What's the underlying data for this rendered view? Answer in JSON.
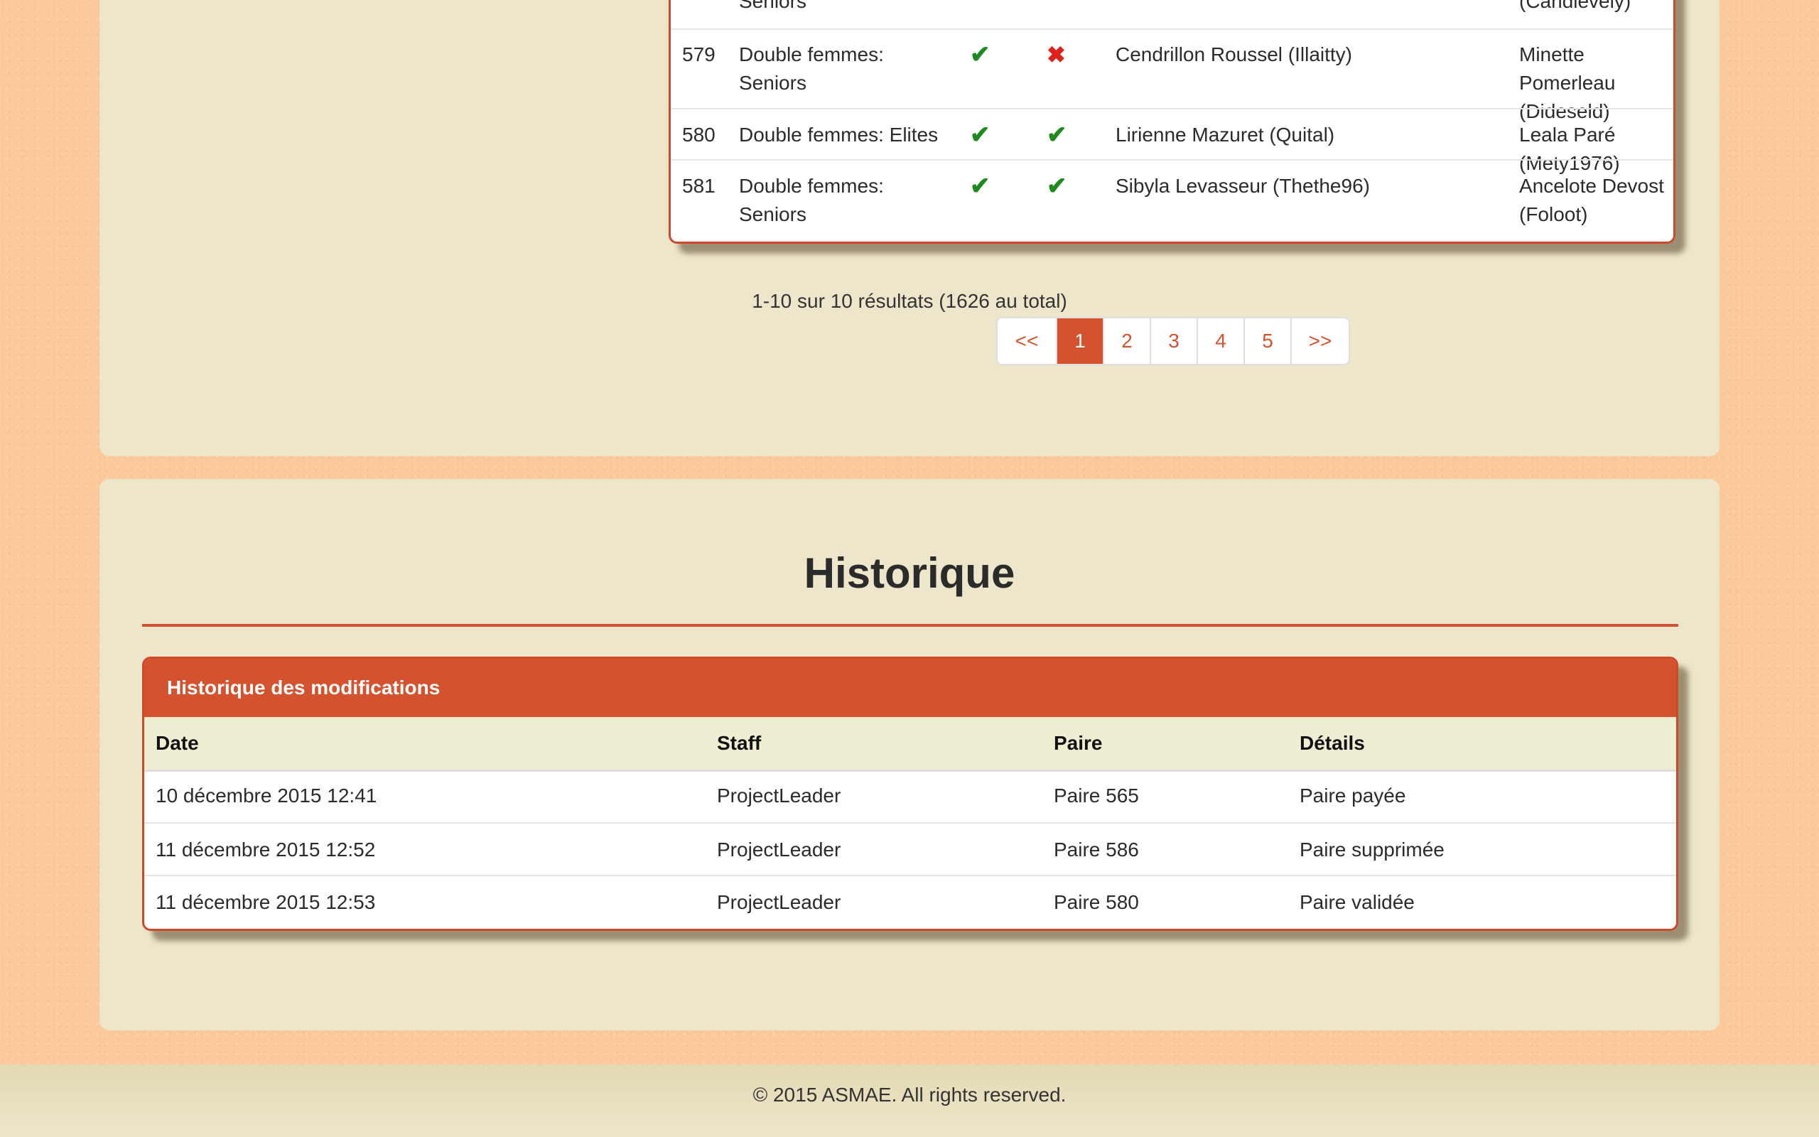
{
  "pairs_table": {
    "rows": [
      {
        "id": "",
        "category": "Seniors",
        "col1": "",
        "col2": "",
        "player1": "",
        "player2": "(Candievely)"
      },
      {
        "id": "579",
        "category": "Double femmes: Seniors",
        "col1": "check",
        "col2": "cross",
        "player1": "Cendrillon Roussel (Illaitty)",
        "player2": "Minette Pomerleau (Dideseld)"
      },
      {
        "id": "580",
        "category": "Double femmes: Elites",
        "col1": "check",
        "col2": "check",
        "player1": "Lirienne Mazuret (Quital)",
        "player2": "Leala Paré (Mety1976)"
      },
      {
        "id": "581",
        "category": "Double femmes: Seniors",
        "col1": "check",
        "col2": "check",
        "player1": "Sibyla Levasseur (Thethe96)",
        "player2": "Ancelote Devost (Foloot)"
      }
    ],
    "glyphs": {
      "check": "✔",
      "cross": "✖"
    },
    "colors": {
      "check": "#1f8a1f",
      "cross": "#e0201a"
    }
  },
  "pagination": {
    "summary": "1-10 sur 10 résultats (1626 au total)",
    "first": "<<",
    "pages": [
      "1",
      "2",
      "3",
      "4",
      "5"
    ],
    "current": "1",
    "last": ">>"
  },
  "history": {
    "title": "Historique",
    "panel_title": "Historique des modifications",
    "columns": {
      "date": "Date",
      "staff": "Staff",
      "pair": "Paire",
      "details": "Détails"
    },
    "rows": [
      {
        "date": "10 décembre 2015 12:41",
        "staff": "ProjectLeader",
        "pair": "Paire 565",
        "details": "Paire payée"
      },
      {
        "date": "11 décembre 2015 12:52",
        "staff": "ProjectLeader",
        "pair": "Paire 586",
        "details": "Paire supprimée"
      },
      {
        "date": "11 décembre 2015 12:53",
        "staff": "ProjectLeader",
        "pair": "Paire 580",
        "details": "Paire validée"
      }
    ]
  },
  "footer": {
    "text": "© 2015 ASMAE. All rights reserved."
  },
  "theme": {
    "accent": "#d4532e",
    "panel_bg": "#ede6cb",
    "page_bg": "#fbc99a"
  }
}
